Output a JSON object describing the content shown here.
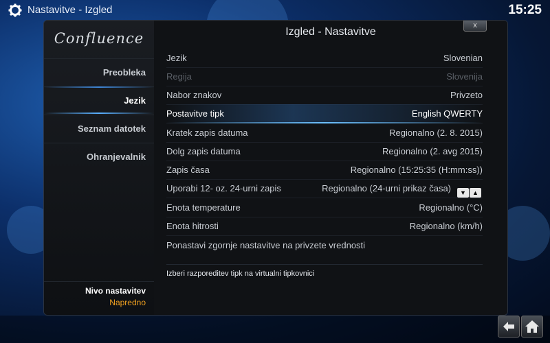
{
  "topbar": {
    "breadcrumb": "Nastavitve - Izgled",
    "clock": "15:25"
  },
  "sidebar": {
    "logo": "Confluence",
    "items": [
      {
        "label": "Preobleka"
      },
      {
        "label": "Jezik"
      },
      {
        "label": "Seznam datotek"
      },
      {
        "label": "Ohranjevalnik"
      }
    ],
    "level_label": "Nivo nastavitev",
    "level_value": "Napredno"
  },
  "dialog": {
    "title": "Izgled - Nastavitve",
    "close_label": "x",
    "rows": [
      {
        "label": "Jezik",
        "value": "Slovenian"
      },
      {
        "label": "Regija",
        "value": "Slovenija"
      },
      {
        "label": "Nabor znakov",
        "value": "Privzeto"
      },
      {
        "label": "Postavitve tipk",
        "value": "English QWERTY"
      },
      {
        "label": "Kratek zapis datuma",
        "value": "Regionalno (2. 8. 2015)"
      },
      {
        "label": "Dolg zapis datuma",
        "value": "Regionalno (2. avg 2015)"
      },
      {
        "label": "Zapis časa",
        "value": "Regionalno (15:25:35 (H:mm:ss))"
      },
      {
        "label": "Uporabi 12- oz. 24-urni zapis",
        "value": "Regionalno (24-urni prikaz časa)"
      },
      {
        "label": "Enota temperature",
        "value": "Regionalno (°C)"
      },
      {
        "label": "Enota hitrosti",
        "value": "Regionalno (km/h)"
      },
      {
        "label": "Ponastavi zgornje nastavitve na privzete vrednosti",
        "value": ""
      }
    ],
    "hint": "Izberi razporeditev tipk na virtualni tipkovnici"
  },
  "icons": {
    "settings": "gear-icon",
    "back": "back-arrow-icon",
    "home": "home-icon",
    "spin_down": "arrow-down-icon",
    "spin_up": "arrow-up-icon"
  }
}
